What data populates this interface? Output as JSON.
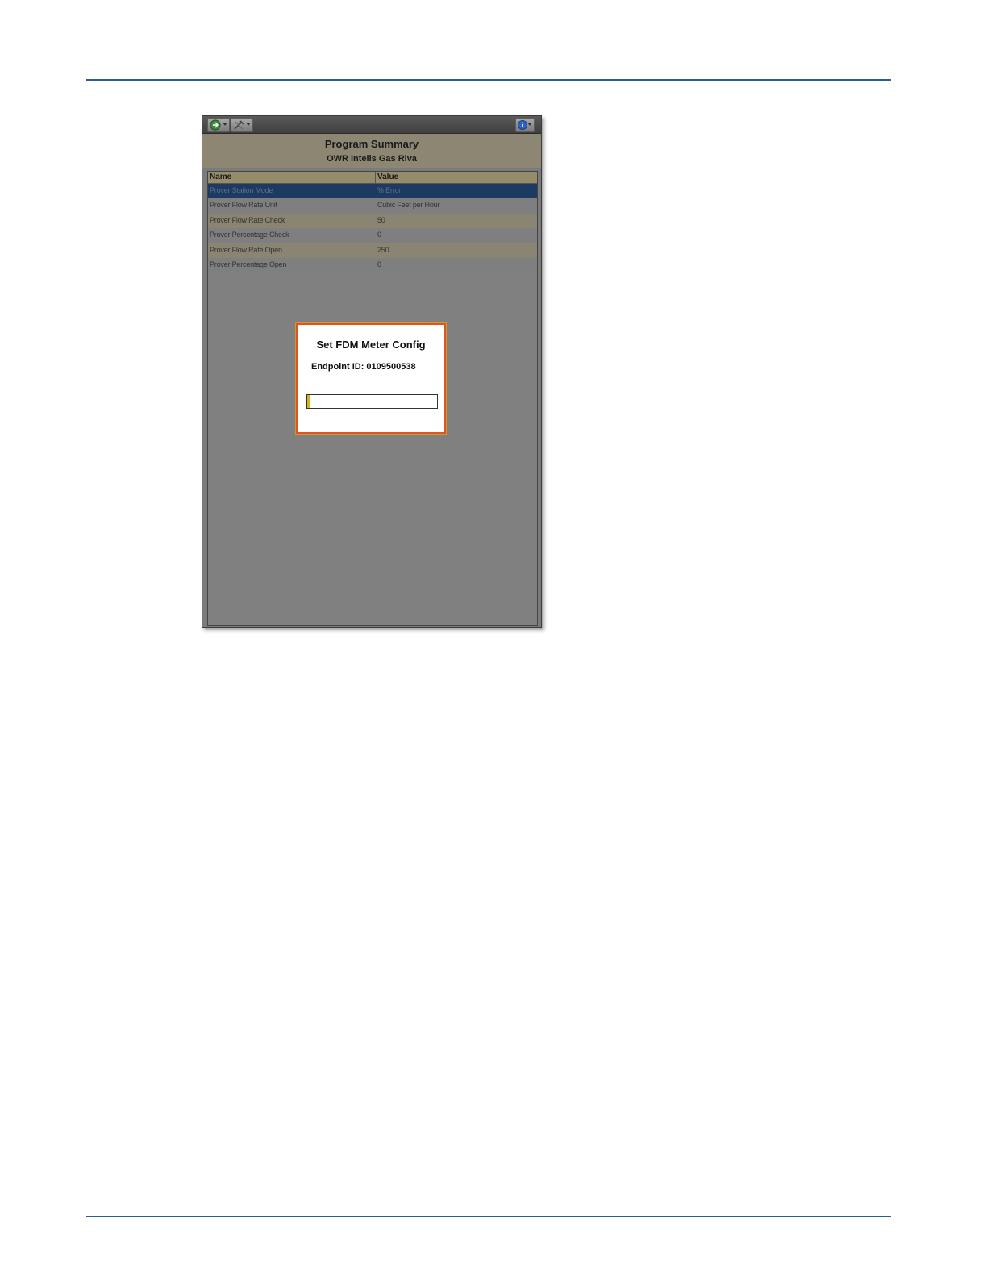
{
  "window": {
    "title": "Program Summary",
    "subtitle": "OWR Intelis Gas Riva"
  },
  "toolbar": {
    "icons": [
      "navigate-icon",
      "tools-icon",
      "info-icon"
    ]
  },
  "table": {
    "columns": [
      "Name",
      "Value"
    ],
    "rows": [
      {
        "name": "Prover Station Mode",
        "value": "% Error",
        "selected": true
      },
      {
        "name": "Prover Flow Rate Unit",
        "value": "Cubic Feet per Hour"
      },
      {
        "name": "Prover Flow Rate Check",
        "value": "50"
      },
      {
        "name": "Prover Percentage Check",
        "value": "0"
      },
      {
        "name": "Prover Flow Rate Open",
        "value": "250"
      },
      {
        "name": "Prover Percentage Open",
        "value": "0"
      }
    ]
  },
  "dialog": {
    "title": "Set FDM Meter Config",
    "endpoint": "Endpoint ID: 0109500538",
    "progress": 0.02
  },
  "colors": {
    "accent_rule": "#2a5d8f",
    "dialog_border": "#e4531e",
    "progress_fill": "#d9b21a",
    "selected_row": "#1d3a63"
  }
}
